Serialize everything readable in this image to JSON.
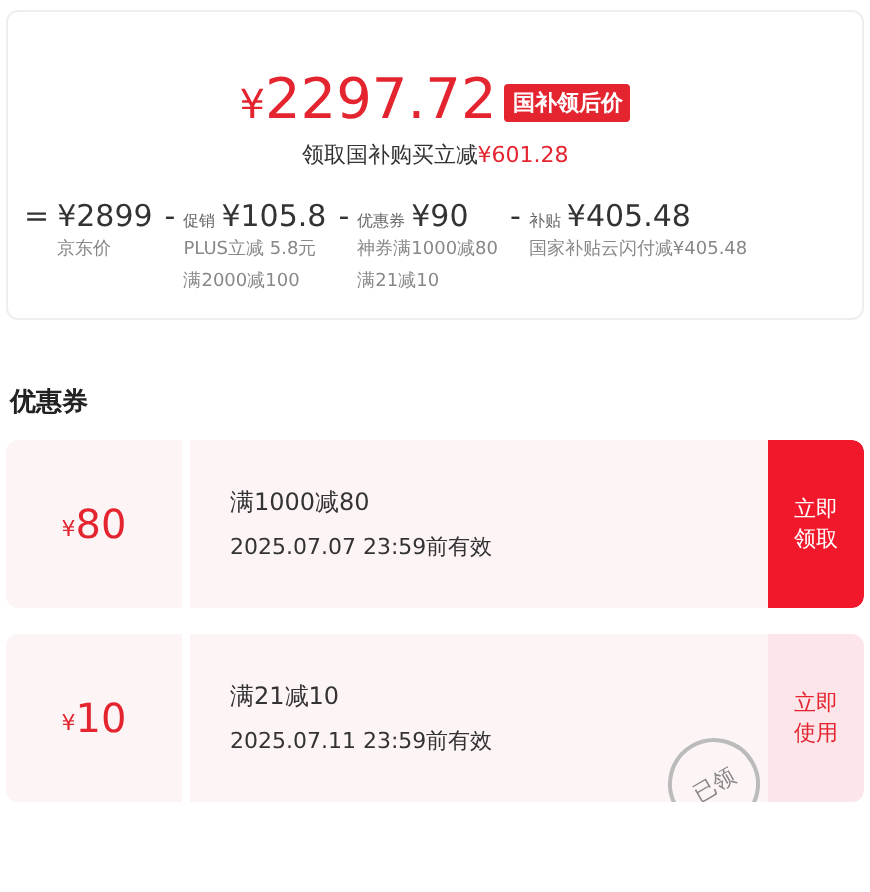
{
  "price": {
    "currency": "¥",
    "amount": "2297.72",
    "badge": "国补领后价"
  },
  "saving": {
    "label": "领取国补购买立减",
    "amount": "¥601.28"
  },
  "breakdown": [
    {
      "op": "=",
      "amount": "¥2899",
      "notes": [
        "京东价"
      ]
    },
    {
      "op": "-",
      "label": "促销",
      "amount": "¥105.8",
      "notes": [
        "PLUS立减 5.8元",
        "满2000减100"
      ]
    },
    {
      "op": "-",
      "label": "优惠券",
      "amount": "¥90",
      "notes": [
        "神券满1000减80",
        "满21减10"
      ]
    },
    {
      "op": "-",
      "label": "补贴",
      "amount": "¥405.48",
      "notes": [
        "国家补贴云闪付减¥405.48"
      ]
    }
  ],
  "coupons_title": "优惠券",
  "coupons": [
    {
      "currency": "¥",
      "value": "80",
      "condition": "满1000减80",
      "expiry": "2025.07.07 23:59前有效",
      "action": "立即领取",
      "claimed": false
    },
    {
      "currency": "¥",
      "value": "10",
      "condition": "满21减10",
      "expiry": "2025.07.11 23:59前有效",
      "action": "立即使用",
      "claimed": true,
      "stamp": "已领"
    }
  ]
}
